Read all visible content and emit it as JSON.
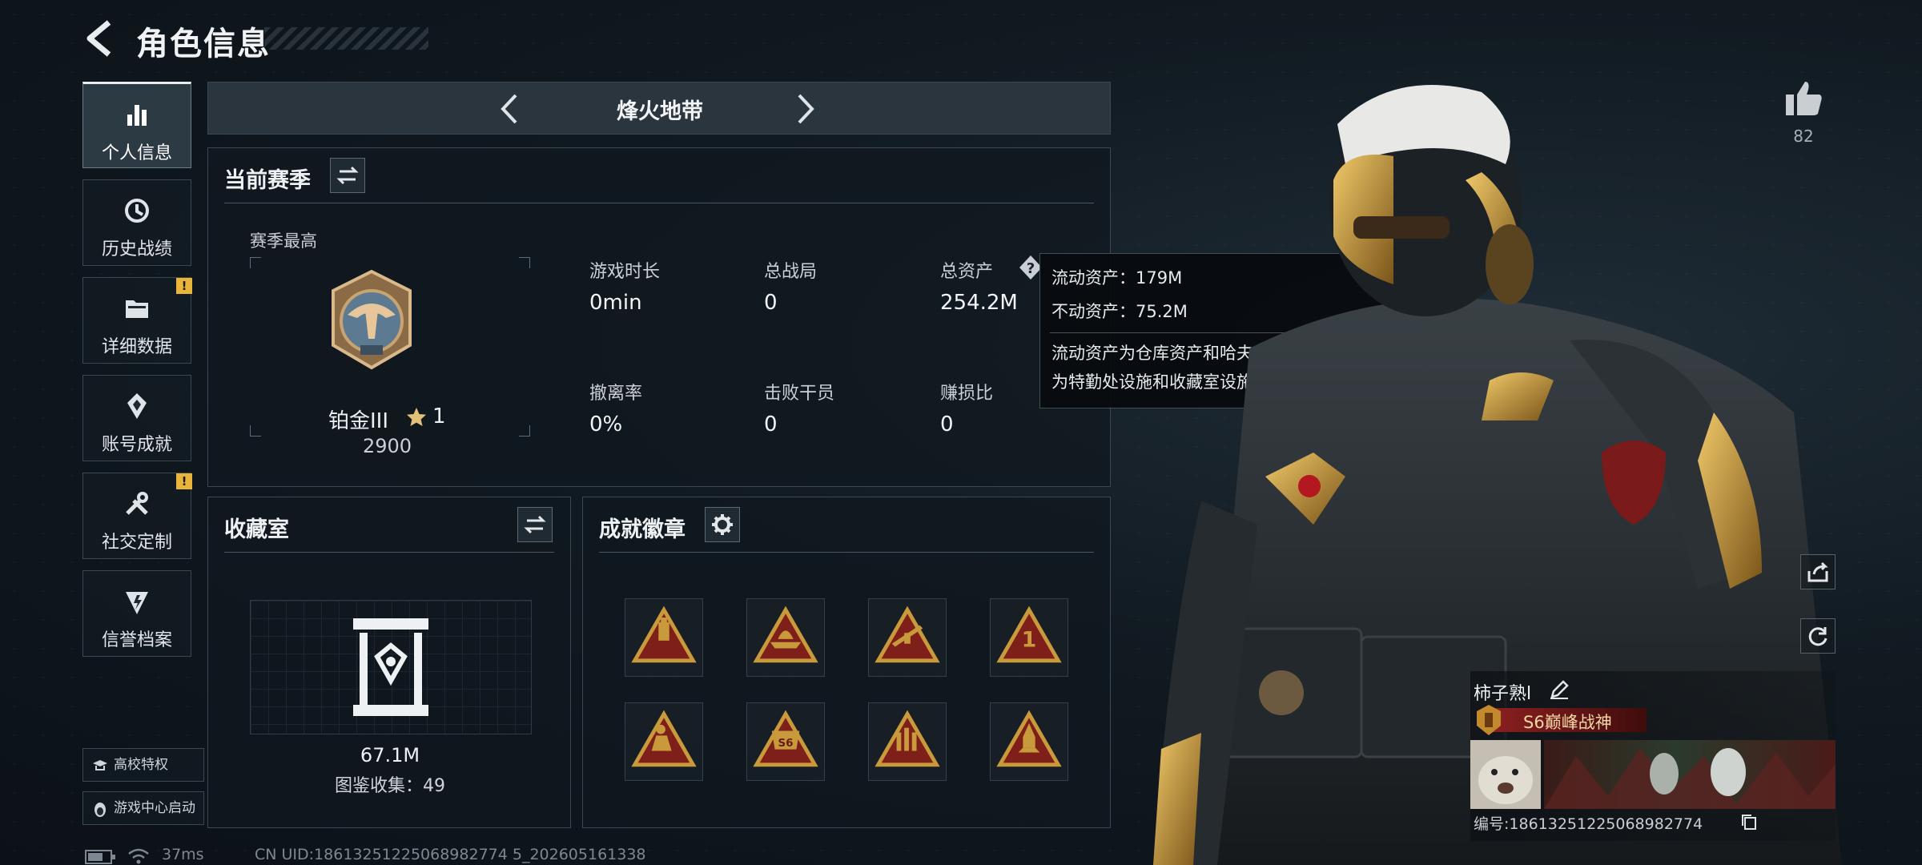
{
  "header": {
    "title": "角色信息"
  },
  "nav": [
    {
      "label": "个人信息",
      "icon": "bar-chart-icon",
      "active": true,
      "alert": false
    },
    {
      "label": "历史战绩",
      "icon": "history-icon",
      "active": false,
      "alert": false
    },
    {
      "label": "详细数据",
      "icon": "folder-icon",
      "active": false,
      "alert": true
    },
    {
      "label": "账号成就",
      "icon": "achievement-icon",
      "active": false,
      "alert": false
    },
    {
      "label": "社交定制",
      "icon": "wrench-icon",
      "active": false,
      "alert": true
    },
    {
      "label": "信誉档案",
      "icon": "credit-shield-icon",
      "active": false,
      "alert": false
    }
  ],
  "alert_mark": "!",
  "side_buttons": {
    "campus": "高校特权",
    "game_center": "游戏中心启动"
  },
  "mode": {
    "title": "烽火地带"
  },
  "season": {
    "title": "当前赛季",
    "best_label": "赛季最高",
    "rank_name": "铂金III",
    "rank_stars": "1",
    "rank_score": "2900",
    "stats": [
      {
        "label": "游戏时长",
        "value": "0min"
      },
      {
        "label": "总战局",
        "value": "0"
      },
      {
        "label": "总资产",
        "value": "254.2M"
      },
      {
        "label": "撤离率",
        "value": "0%"
      },
      {
        "label": "击败干员",
        "value": "0"
      },
      {
        "label": "赚损比",
        "value": "0"
      }
    ]
  },
  "tooltip": {
    "liquid": "流动资产：179M",
    "fixed": "不动资产：75.2M",
    "desc_1": "流动资产为仓库资产和哈夫币，不动资产",
    "desc_2": "为特勤处设施和收藏室设施"
  },
  "collection": {
    "title": "收藏室",
    "value": "67.1M",
    "catalog": "图鉴收集：49"
  },
  "badges": {
    "title": "成就徽章",
    "items": [
      {
        "icon": "bottle-badge-icon"
      },
      {
        "icon": "ship-badge-icon"
      },
      {
        "icon": "weapon-badge-icon"
      },
      {
        "icon": "rank-one-badge-icon"
      },
      {
        "icon": "climber-badge-icon"
      },
      {
        "icon": "s6-badge-icon",
        "text": "S6"
      },
      {
        "icon": "ammo-badge-icon"
      },
      {
        "icon": "rocket-badge-icon"
      }
    ]
  },
  "likes": {
    "count": "82"
  },
  "player": {
    "name": "柿子熟l",
    "title": "S6巅峰战神",
    "id_text": "编号:18613251225068982774"
  },
  "status": {
    "ping": "37ms",
    "uid": "CN UID:18613251225068982774 5_202605161338"
  },
  "colors": {
    "accent_gold": "#c99a3c",
    "alert_yellow": "#e8b43a",
    "title_red": "#6d1d1d"
  }
}
